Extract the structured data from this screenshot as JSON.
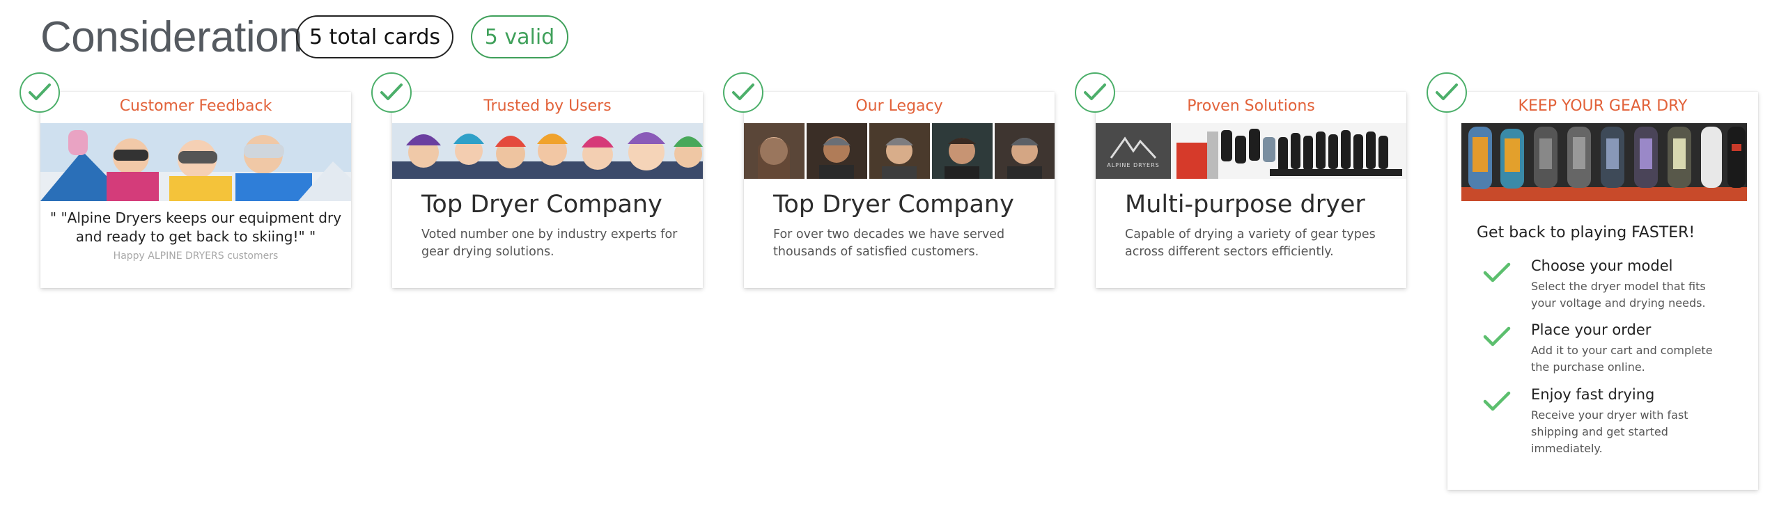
{
  "header": {
    "title": "Consideration",
    "total_badge": "5 total cards",
    "valid_badge": "5 valid"
  },
  "cards": [
    {
      "label": "Customer Feedback",
      "quote": "\" \"Alpine Dryers keeps our equipment dry and ready to get back to skiing!\" \"",
      "attribution": "Happy ALPINE DRYERS customers"
    },
    {
      "label": "Trusted by Users",
      "headline": "Top Dryer Company",
      "description": "Voted number one by industry experts for gear drying solutions."
    },
    {
      "label": "Our Legacy",
      "headline": "Top Dryer Company",
      "description": "For over two decades we have served thousands of satisfied customers."
    },
    {
      "label": "Proven Solutions",
      "headline": "Multi-purpose dryer",
      "description": "Capable of drying a variety of gear types across different sectors efficiently.",
      "logo_text": "ALPINE DRYERS"
    },
    {
      "label": "KEEP YOUR GEAR DRY",
      "intro": "Get back to playing FASTER!",
      "steps": [
        {
          "title": "Choose your model",
          "desc": "Select the dryer model that fits your voltage and drying needs."
        },
        {
          "title": "Place your order",
          "desc": "Add it to your cart and complete the purchase online."
        },
        {
          "title": "Enjoy fast drying",
          "desc": "Receive your dryer with fast shipping and get started immediately."
        }
      ]
    }
  ],
  "colors": {
    "accent": "#e2623a",
    "valid": "#3fa05a",
    "check": "#4caf6a"
  },
  "icons": {
    "badge": "check-icon",
    "step": "check-icon"
  }
}
